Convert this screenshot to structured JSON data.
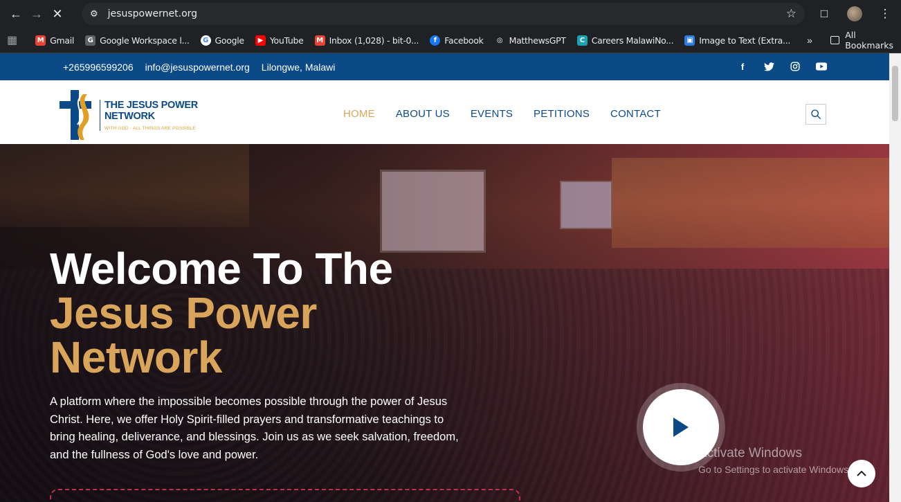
{
  "browser": {
    "url": "jesuspowernet.org",
    "bookmarks": [
      {
        "label": "Gmail",
        "icon": "gmail-icon",
        "color": "#ea4335"
      },
      {
        "label": "Google Workspace l...",
        "icon": "workspace-icon",
        "color": "#5f6368"
      },
      {
        "label": "Google",
        "icon": "google-icon",
        "color": "#4285f4"
      },
      {
        "label": "YouTube",
        "icon": "youtube-icon",
        "color": "#ff0000"
      },
      {
        "label": "Inbox (1,028) - bit-0...",
        "icon": "gmail-icon",
        "color": "#ea4335"
      },
      {
        "label": "Facebook",
        "icon": "facebook-icon",
        "color": "#1877f2"
      },
      {
        "label": "MatthewsGPT",
        "icon": "openai-icon",
        "color": "#ffffff"
      },
      {
        "label": "Careers MalawiNo...",
        "icon": "careers-icon",
        "color": "#1aa3b0"
      },
      {
        "label": "Image to Text (Extra...",
        "icon": "image-text-icon",
        "color": "#2a7de1"
      }
    ],
    "all_bookmarks": "All Bookmarks"
  },
  "topbar": {
    "phone": "+265996599206",
    "email": "info@jesuspowernet.org",
    "location": "Lilongwe, Malawi",
    "socials": [
      "facebook-icon",
      "twitter-icon",
      "instagram-icon",
      "youtube-icon"
    ]
  },
  "logo": {
    "title_line1": "THE JESUS POWER",
    "title_line2": "NETWORK",
    "tagline": "WITH GOD - ALL THINGS ARE POSSIBLE"
  },
  "nav": {
    "items": [
      "HOME",
      "ABOUT US",
      "EVENTS",
      "PETITIONS",
      "CONTACT"
    ],
    "active": "HOME"
  },
  "hero": {
    "line1": "Welcome To The",
    "line2": "Jesus Power",
    "line3": "Network",
    "description": "A platform where the impossible becomes possible through the power of Jesus Christ. Here, we offer Holy Spirit-filled prayers and transformative teachings to bring healing, deliverance, and blessings. Join us as we seek salvation, freedom, and the fullness of God's love and power."
  },
  "watermark": {
    "line1": "Activate Windows",
    "line2": "Go to Settings to activate Windows."
  },
  "colors": {
    "brand_blue": "#0b4a87",
    "gold": "#d9a55a"
  }
}
